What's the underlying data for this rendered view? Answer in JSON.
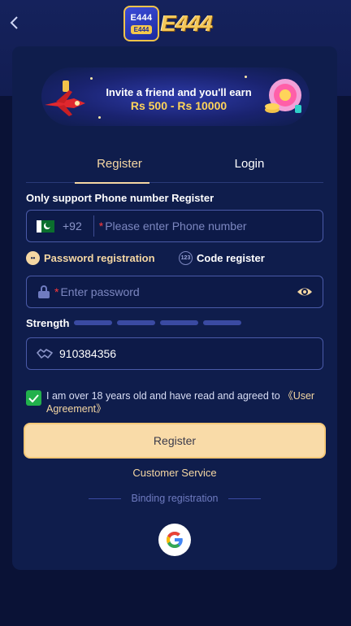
{
  "header": {
    "logo_badge_top": "E444",
    "logo_badge_bottom": "E444",
    "logo_text": "E444"
  },
  "banner": {
    "line1": "Invite a friend and you'll earn",
    "line2": "Rs 500 - Rs 10000"
  },
  "tabs": [
    {
      "label": "Register",
      "active": true
    },
    {
      "label": "Login",
      "active": false
    }
  ],
  "form": {
    "phone_section_label": "Only support Phone number Register",
    "country_code": "+92",
    "required_mark": "*",
    "phone_placeholder": "Please enter Phone number",
    "mode_password": "Password registration",
    "mode_code": "Code register",
    "password_placeholder": "Enter password",
    "strength_label": "Strength",
    "strength_level": 0,
    "invite_code": "910384356",
    "agree_checked": true,
    "agree_text": "I am over 18 years old and have read and agreed to",
    "agree_link": "《User Agreement》",
    "register_button": "Register"
  },
  "footer": {
    "customer_service": "Customer Service",
    "binding_label": "Binding registration"
  },
  "colors": {
    "accent": "#f5d7a3",
    "button_bg": "#f9dba8",
    "check_green": "#22b14c",
    "card_bg": "#0f1d4c"
  }
}
